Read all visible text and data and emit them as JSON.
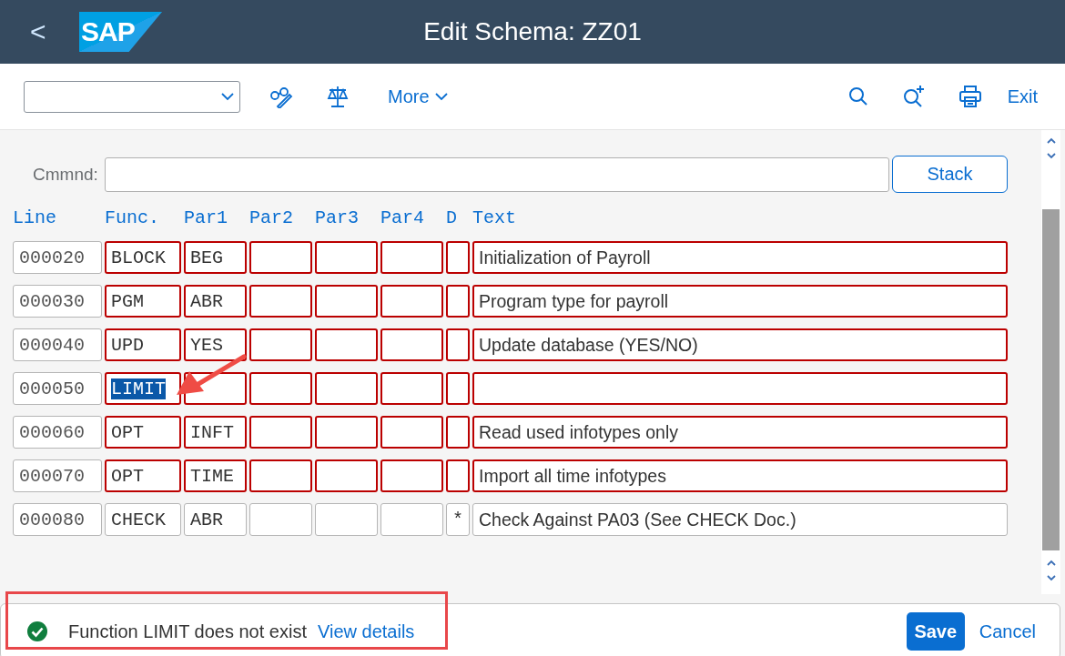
{
  "header": {
    "back": "<",
    "logo": "SAP",
    "title": "Edit Schema: ZZ01"
  },
  "toolbar": {
    "more": "More",
    "exit": "Exit"
  },
  "command": {
    "label": "Cmmnd:",
    "stack": "Stack"
  },
  "columns": [
    "Line",
    "Func.",
    "Par1",
    "Par2",
    "Par3",
    "Par4",
    "D",
    "Text"
  ],
  "rows": [
    {
      "line": "000020",
      "func": "BLOCK",
      "par1": "BEG",
      "par2": "",
      "par3": "",
      "par4": "",
      "d": "",
      "text": "Initialization of Payroll",
      "flagged": true,
      "func_selected": false
    },
    {
      "line": "000030",
      "func": "PGM",
      "par1": "ABR",
      "par2": "",
      "par3": "",
      "par4": "",
      "d": "",
      "text": "Program type for payroll",
      "flagged": true,
      "func_selected": false
    },
    {
      "line": "000040",
      "func": "UPD",
      "par1": "YES",
      "par2": "",
      "par3": "",
      "par4": "",
      "d": "",
      "text": "Update database (YES/NO)",
      "flagged": true,
      "func_selected": false
    },
    {
      "line": "000050",
      "func": "LIMIT",
      "par1": "",
      "par2": "",
      "par3": "",
      "par4": "",
      "d": "",
      "text": "",
      "flagged": true,
      "func_selected": true
    },
    {
      "line": "000060",
      "func": "OPT",
      "par1": "INFT",
      "par2": "",
      "par3": "",
      "par4": "",
      "d": "",
      "text": "Read used infotypes only",
      "flagged": true,
      "func_selected": false
    },
    {
      "line": "000070",
      "func": "OPT",
      "par1": "TIME",
      "par2": "",
      "par3": "",
      "par4": "",
      "d": "",
      "text": "Import all time infotypes",
      "flagged": true,
      "func_selected": false
    },
    {
      "line": "000080",
      "func": "CHECK",
      "par1": "ABR",
      "par2": "",
      "par3": "",
      "par4": "",
      "d": "*",
      "text": "Check Against PA03 (See CHECK Doc.)",
      "flagged": false,
      "func_selected": false
    }
  ],
  "footer": {
    "message": "Function LIMIT does not exist",
    "details": "View details",
    "save": "Save",
    "cancel": "Cancel"
  }
}
